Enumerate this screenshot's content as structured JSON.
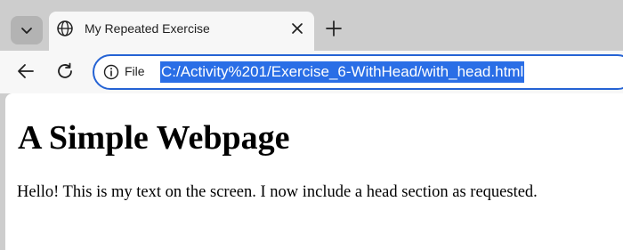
{
  "tab": {
    "title": "My Repeated Exercise"
  },
  "omnibox": {
    "chip_label": "File",
    "url": "C:/Activity%201/Exercise_6-WithHead/with_head.html"
  },
  "page": {
    "heading": "A Simple Webpage",
    "paragraph": "Hello! This is my text on the screen. I now include a head section as requested."
  },
  "icons": {
    "tab_list": "chevron-down-icon",
    "favicon": "globe-icon",
    "close": "close-icon",
    "new_tab": "plus-icon",
    "back": "arrow-left-icon",
    "reload": "reload-icon",
    "site_info": "info-icon"
  },
  "colors": {
    "url_selection": "#2a6ee6",
    "omnibox_focus_border": "#2563d4",
    "tabstrip_bg": "#cdcdcd"
  }
}
